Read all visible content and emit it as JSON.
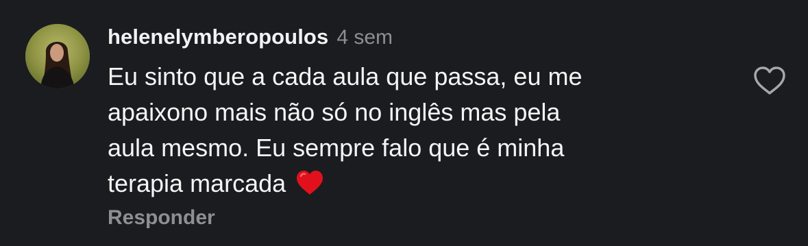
{
  "comment": {
    "username": "helenelymberopoulos",
    "timestamp": "4 sem",
    "text_lines": [
      "Eu sinto que a cada aula que passa, eu me",
      "apaixono mais não só no inglês mas pela",
      "aula mesmo. Eu sempre falo que é minha",
      "terapia marcada"
    ],
    "emoji": "red-heart",
    "reply_label": "Responder",
    "like_icon": "heart-outline-icon"
  },
  "colors": {
    "background": "#1b1c20",
    "text": "#f5f5f5",
    "muted": "#8e8e93",
    "heart_red": "#e0111c"
  }
}
